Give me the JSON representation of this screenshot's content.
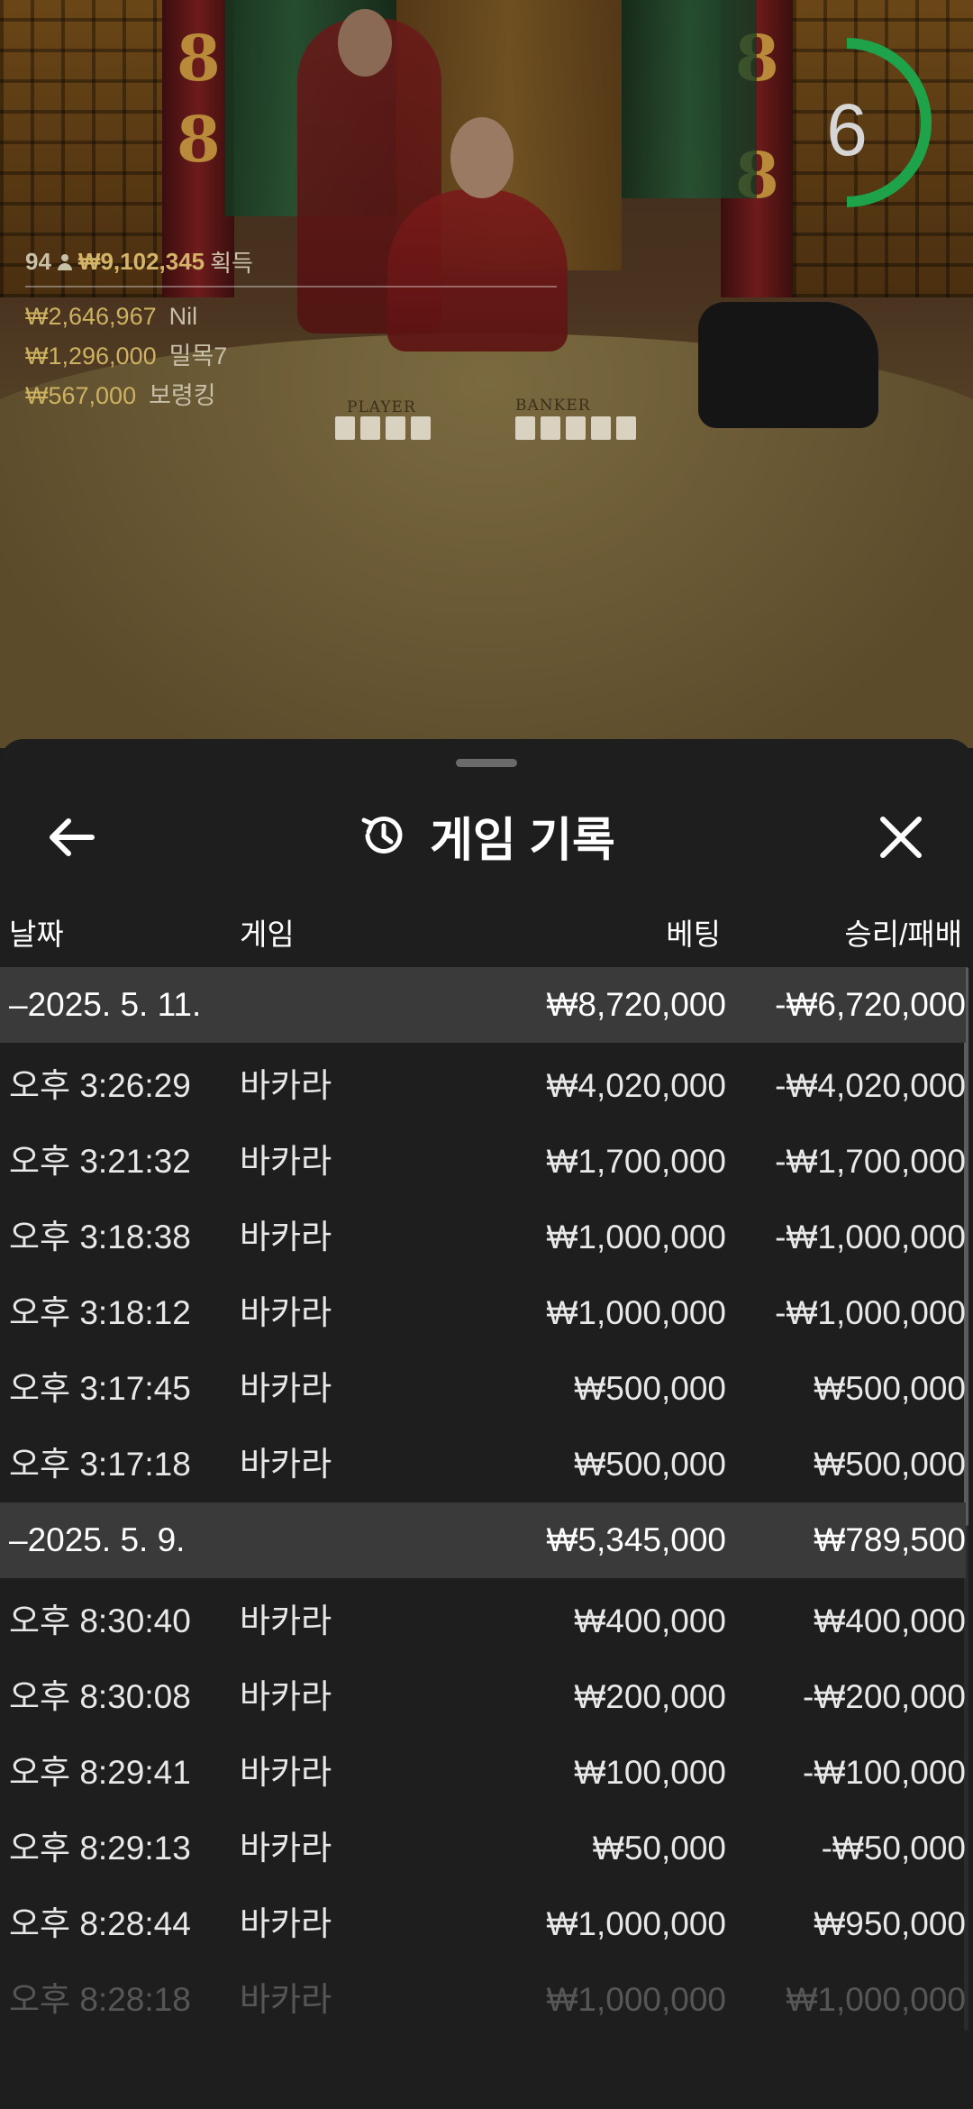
{
  "countdown": {
    "value": "6",
    "ring_color": "#1fa34a"
  },
  "stats": {
    "player_count": "94",
    "total_won": "₩9,102,345",
    "total_won_suffix": "획득",
    "winners": [
      {
        "amount": "₩2,646,967",
        "name": "Nil"
      },
      {
        "amount": "₩1,296,000",
        "name": "밀목7"
      },
      {
        "amount": "₩567,000",
        "name": "보령킹"
      }
    ]
  },
  "table": {
    "player_label": "PLAYER",
    "banker_label": "BANKER"
  },
  "sheet": {
    "title": "게임 기록",
    "title_icon": "history-icon",
    "back_icon": "arrow-left-icon",
    "close_icon": "close-icon",
    "columns": {
      "date": "날짜",
      "game": "게임",
      "bet": "베팅",
      "result": "승리/패배"
    },
    "groups": [
      {
        "date": "–2025. 5. 11.",
        "bet": "₩8,720,000",
        "result": "-₩6,720,000",
        "items": [
          {
            "time": "오후 3:26:29",
            "game": "바카라",
            "bet": "₩4,020,000",
            "result": "-₩4,020,000"
          },
          {
            "time": "오후 3:21:32",
            "game": "바카라",
            "bet": "₩1,700,000",
            "result": "-₩1,700,000"
          },
          {
            "time": "오후 3:18:38",
            "game": "바카라",
            "bet": "₩1,000,000",
            "result": "-₩1,000,000"
          },
          {
            "time": "오후 3:18:12",
            "game": "바카라",
            "bet": "₩1,000,000",
            "result": "-₩1,000,000"
          },
          {
            "time": "오후 3:17:45",
            "game": "바카라",
            "bet": "₩500,000",
            "result": "₩500,000"
          },
          {
            "time": "오후 3:17:18",
            "game": "바카라",
            "bet": "₩500,000",
            "result": "₩500,000"
          }
        ]
      },
      {
        "date": "–2025. 5. 9.",
        "bet": "₩5,345,000",
        "result": "₩789,500",
        "items": [
          {
            "time": "오후 8:30:40",
            "game": "바카라",
            "bet": "₩400,000",
            "result": "₩400,000"
          },
          {
            "time": "오후 8:30:08",
            "game": "바카라",
            "bet": "₩200,000",
            "result": "-₩200,000"
          },
          {
            "time": "오후 8:29:41",
            "game": "바카라",
            "bet": "₩100,000",
            "result": "-₩100,000"
          },
          {
            "time": "오후 8:29:13",
            "game": "바카라",
            "bet": "₩50,000",
            "result": "-₩50,000"
          },
          {
            "time": "오후 8:28:44",
            "game": "바카라",
            "bet": "₩1,000,000",
            "result": "₩950,000"
          },
          {
            "time": "오후 8:28:18",
            "game": "바카라",
            "bet": "₩1,000,000",
            "result": "₩1,000,000"
          }
        ]
      }
    ]
  }
}
